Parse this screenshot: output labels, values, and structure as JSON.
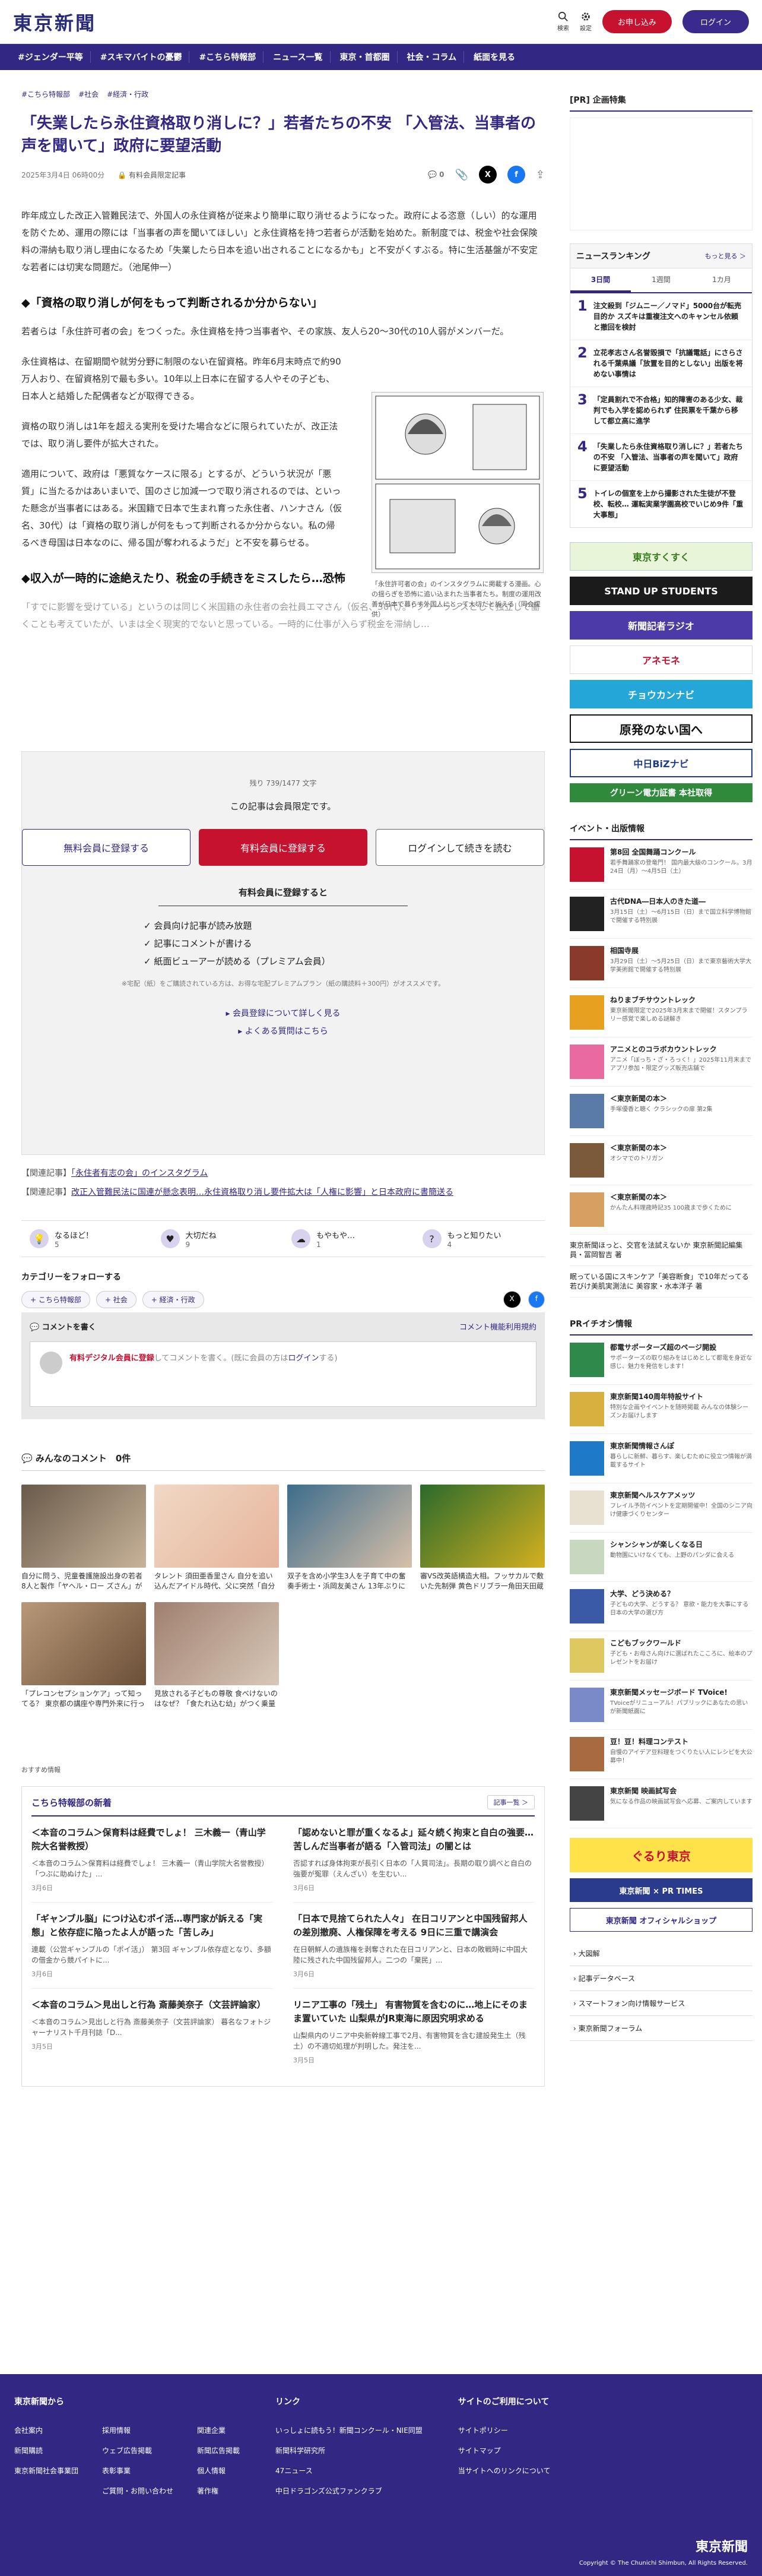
{
  "header": {
    "logo": "東京新聞",
    "search_label": "検索",
    "settings_label": "設定",
    "register": "お申し込み",
    "login": "ログイン"
  },
  "nav": [
    "#ジェンダー平等",
    "#スキマバイトの憂鬱",
    "#こちら特報部",
    "ニュース一覧",
    "東京・首都圏",
    "社会・コラム",
    "紙面を見る"
  ],
  "crumbs": [
    "#こちら特報部",
    "#社会",
    "#経済・行政"
  ],
  "article": {
    "title": "「失業したら永住資格取り消しに？」若者たちの不安 「入管法、当事者の声を聞いて」政府に要望活動",
    "date": "2025年3月4日 06時00分",
    "badge": "有料会員限定記事",
    "comment_count": "0",
    "p1": "昨年成立した改正入管難民法で、外国人の永住資格が従来より簡単に取り消せるようになった。政府による恣意（しい）的な運用を防ぐため、運用の際には「当事者の声を聞いてほしい」と永住資格を持つ若者らが活動を始めた。新制度では、税金や社会保険料の滞納も取り消し理由になるため「失業したら日本を追い出されることになるかも」と不安がくすぶる。特に生活基盤が不安定な若者には切実な問題だ。（池尾伸一）",
    "h_1": "◆「資格の取り消しが何をもって判断されるか分からない」",
    "p2": "若者らは「永住許可者の会」をつくった。永住資格を持つ当事者や、その家族、友人ら20〜30代の10人弱がメンバーだ。",
    "p3": "永住資格は、在留期間や就労分野に制限のない在留資格。昨年6月末時点で約90万人おり、在留資格別で最も多い。10年以上日本に在留する人やその子ども、日本人と結婚した配偶者などが取得できる。",
    "p4": "資格の取り消しは1年を超える実刑を受けた場合などに限られていたが、改正法では、取り消し要件が拡大された。",
    "p5": "適用について、政府は「悪質なケースに限る」とするが、どういう状況が「悪質」に当たるかはあいまいで、国のさじ加減一つで取り消されるのでは、といった懸念が当事者にはある。米国籍で日本で生まれ育った永住者、ハンナさん（仮名、30代）は「資格の取り消しが何をもって判断されるか分からない。私の帰るべき母国は日本なのに、帰る国が奪われるようだ」と不安を募らせる。",
    "h_2": "◆収入が一時的に途絶えたり、税金の手続きをミスしたら…恐怖",
    "p6": "「すでに影響を受けている」というのは同じく米国籍の永住者の会社員エマさん（仮名、30代）。「フリーランスとして独立して働くことも考えていたが、いまは全く現実的でないと思っている。一時的に仕事が入らず税金を滞納し…",
    "fig_caption": "「永住許可者の会」のインスタグラムに掲載する漫画。心の揺らぎを恐怖に追い込まれた当事者たち。制度の運用改善が日本で暮らす外国人にとって大切だと訴える（同会提供）"
  },
  "paywall": {
    "count": "残り 739/1477 文字",
    "msg": "この記事は会員限定です。",
    "free": "無料会員に登録する",
    "paid": "有料会員に登録する",
    "login": "ログインして続きを読む",
    "benefits_head": "有料会員に登録すると",
    "benefits": [
      "✓ 会員向け記事が読み放題",
      "✓ 記事にコメントが書ける",
      "✓ 紙面ビューアーが読める（プレミアム会員）"
    ],
    "note": "※宅配（紙）をご購読されている方は、お得な宅配プレミアムプラン（紙の購読料＋300円）がオススメです。",
    "link1": "会員登録について詳しく見る",
    "link2": "よくある質問はこちら"
  },
  "related": [
    {
      "label": "【関連記事】",
      "text": "「永住者有志の会」のインスタグラム"
    },
    {
      "label": "【関連記事】",
      "text": "改正入管難民法に国連が懸念表明…永住資格取り消し要件拡大は「人権に影響」と日本政府に書簡送る"
    }
  ],
  "reactions": [
    {
      "label": "なるほど！",
      "count": "5"
    },
    {
      "label": "大切だね",
      "count": "9"
    },
    {
      "label": "もやもや…",
      "count": "1"
    },
    {
      "label": "もっと知りたい",
      "count": "4"
    }
  ],
  "follow": {
    "head": "カテゴリーをフォローする",
    "chips": [
      "+ こちら特報部",
      "+ 社会",
      "+ 経済・行政"
    ]
  },
  "comments": {
    "head": "コメントを書く",
    "policy": "コメント機能利用規約",
    "ph_a": "有料デジタル会員に登録",
    "ph_b": "してコメントを書く。(既に会員の方は",
    "ph_c": "ログイン",
    "ph_d": "する)",
    "all": "みんなのコメント　0件"
  },
  "cards": [
    {
      "cap": "自分に問う、児童養護施設出身の若者8人と製作「ヤヘル・ロー ズさん」が記監督映画「花束」…"
    },
    {
      "cap": "タレント 須田亜香里さん 自分を追い込んだアイドル時代、父に突然「自分の心に貧乏ゆすり..."
    },
    {
      "cap": "双子を含め小学生3人を子育て中の奮奏手術士・浜岡友美さん 13年ぶりに「おはよう日本」..."
    },
    {
      "cap": "審VS改英語構造大相。フッサカルで敷いた先制弾 黄色ドリブラ一角田天田蔵が上位に 〜全..."
    },
    {
      "cap": "「プレコンセプションケア」って知ってる？ 東京都の講座や専門外来に行ってみた"
    },
    {
      "cap": "見放される子どもの尊敬 食べけないのはなぜ？「食たれ込む幼」がつく乗量様をよ作売..."
    }
  ],
  "rec": "おすすめ情報",
  "tokuho": {
    "head": "こちら特報部の新着",
    "more": "記事一覧 ＞",
    "items": [
      {
        "t": "＜本音のコラム＞保育料は経費でしょ！ 三木義一（青山学院大名誉教授）",
        "p": "＜本音のコラム＞保育料は経費でしょ！ 三木義一（青山学院大名誉教授） 「つぶに助ぬけた」...",
        "d": "3月6日"
      },
      {
        "t": "「認めないと罪が重くなるよ」延々続く拘束と自白の強要…苦しんだ当事者が語る「入管司法」の闇とは",
        "p": "否認すれば身体拘束が長引く日本の「人質司法」。長期の取り調べと自白の強要が冤罪（えんざい）を生むい...",
        "d": "3月6日"
      },
      {
        "t": "「ギャンブル脳」につけ込むポイ活…専門家が訴える「実態」と依存症に陥ったよ人が語った「苦しみ」",
        "p": "連載（公営ギャンブルの「ポイ活」） 第3回 ギャンブル依存症となり、多額の借金から競パイトに...",
        "d": "3月6日"
      },
      {
        "t": "「日本で見捨てられた人々」 在日コリアンと中国残留邦人の差別撤廃、人権保障を考える 9日に三重で講演会",
        "p": "在日朝鮮人の遺族権を剥奪された在日コリアンと、日本の敗戦時に中国大陸に残された中国残留邦人。二つの「棄民」...",
        "d": "3月6日"
      },
      {
        "t": "＜本音のコラム＞見出しと行為 斎藤美奈子（文芸評論家）",
        "p": "＜本音のコラム＞見出しと行為 斎藤美奈子（文芸評論家） 暮名なフォトジャーナリスト千月刊誌「D...",
        "d": "3月5日"
      },
      {
        "t": "リニア工事の「残土」 有害物質を含むのに…地上にそのまま置いていた 山梨県がJR東海に原因究明求める",
        "p": "山梨県内のリニア中央新幹線工事で2月、有害物質を含む建設発生土（残土）の不適切処理が判明した。発注を...",
        "d": "3月5日"
      }
    ]
  },
  "side": {
    "pr": "[PR] 企画特集",
    "rank_head": "ニュースランキング",
    "rank_more": "もっと見る ＞",
    "tabs": [
      "3日間",
      "1週間",
      "1カ月"
    ],
    "rank": [
      {
        "n": "1",
        "t": "注文殺到「ジムニー／ノマド」5000台が転売目的か スズキは重複注文へのキャンセル依頼と撤回を検討"
      },
      {
        "n": "2",
        "t": "立花孝志さん名誉毀損で「抗議電話」にさらされる千葉県議「放置を目的としない」出版を将めない事情は"
      },
      {
        "n": "3",
        "t": "「定員割れで不合格」知的障害のある少女、裁判でも入学を認められず 住民票を千葉から移して都立高に進学"
      },
      {
        "n": "4",
        "t": "「失業したら永住資格取り消しに？」若者たちの不安 「入管法、当事者の声を聞いて」政府に要望活動"
      },
      {
        "n": "5",
        "t": "トイレの個室を上から撮影された生徒が不登校、転校… 運転実業学園高校でいじめ9件「重大事態」"
      }
    ],
    "banners": [
      "東京すくすく",
      "STAND UP STUDENTS",
      "新聞記者ラジオ",
      "アネモネ",
      "チョウカンナビ",
      "原発のない国へ",
      "中日BiZナビ",
      "グリーン電力証書 本社取得"
    ],
    "ev_head": "イベント・出版情報",
    "events": [
      {
        "t": "第8回 全国舞踊コンクール",
        "s": "若手舞踊家の登竜門！ 国内最大級のコンクール。3月24日（月）〜4月5日（土）"
      },
      {
        "t": "古代DNA―日本人のきた道―",
        "s": "3月15日（土）〜6月15日（日）まで国立科学博物館で開催する特別展"
      },
      {
        "t": "相国寺展",
        "s": "3月29日（土）〜5月25日（日）まで東京藝術大学大学美術館で開催する特別展"
      },
      {
        "t": "ねりまブチサウントレック",
        "s": "東京新聞限定で2025年3月末まで開催！スタンプラリー感覚で楽しめる謎解き"
      },
      {
        "t": "アニメとのコラボカウントレック",
        "s": "アニメ「ぼっち・ざ・ろっく！」2025年11月末までアプリ参加・限定グッズ販売店舗で"
      },
      {
        "t": "＜東京新聞の本＞",
        "s": "手塚優香と聴く クラシックの扉 第2集"
      },
      {
        "t": "＜東京新聞の本＞",
        "s": "オシマでのトリガン"
      },
      {
        "t": "＜東京新聞の本＞",
        "s": "かんたん料理歳時記35 100歳まで歩くために"
      }
    ],
    "links": [
      "東京新聞ほっと、交官を法試えないか 東京新聞記編集員・冨岡智吉 著",
      "眠っている国にスキンケア「美容断食」で10年だってる若びけ美肌実測法に 美容家・水本洋子 著"
    ],
    "pr_head": "PRイチオシ情報",
    "prs": [
      {
        "t": "都電サポーターズ超のページ開設",
        "s": "サポーターズの取り組みをはじめとして都電を身近な感じ、魅力を発信をします！"
      },
      {
        "t": "東京新聞140周年特設サイト",
        "s": "特別な企画やイベントを随時掲載 みんなの体験シーズンお届けします"
      },
      {
        "t": "東京新聞情報さんぽ",
        "s": "暮らしに新鮮、暮らす、楽しむために役立つ情報が満載するサイト"
      },
      {
        "t": "東京新聞ヘルスケアメッツ",
        "s": "フレイル予防イベントを定期開催中！全国のシニア向け健康づくりセンター"
      },
      {
        "t": "シャンシャンが楽しくなる日",
        "s": "動物園にいけなくても、上野のパンダに会える"
      },
      {
        "t": "大学、どう決める？",
        "s": "子どもの大学、どうする？ 意欲・能力を大事にする日本の大学の選び方"
      },
      {
        "t": "こどもブックワールド",
        "s": "子ども・お母さん向けに選ばれたこころに、絵本のプレゼントをお届け"
      },
      {
        "t": "東京新聞メッセージボード TVoice!",
        "s": "TVoiceがリニューアル！パブリックにあなたの思いが新聞紙面に"
      },
      {
        "t": "豆！豆！料理コンテスト",
        "s": "自慢のアイデア豆料理をつくりたい人にレシピを大公募中！"
      },
      {
        "t": "東京新聞 映画試写会",
        "s": "気になる作品の映画試写会へ応募、ご案内しています"
      }
    ],
    "banners2": [
      "ぐるり東京",
      "東京新聞 × PR TIMES",
      "東京新聞 オフィシャルショップ"
    ],
    "sublinks": [
      "大図解",
      "記事データベース",
      "スマートフォン向け情報サービス",
      "東京新聞フォーラム"
    ]
  },
  "footer": {
    "c1": "東京新聞から",
    "c1a": [
      "会社案内",
      "新聞購読",
      "東京新聞社会事業団"
    ],
    "c1b": [
      "採用情報",
      "ウェブ広告掲載",
      "表彰事業",
      "ご質問・お問い合わせ"
    ],
    "c1c": [
      "関連企業",
      "新聞広告掲載",
      "個人情報",
      "著作権"
    ],
    "c2": "リンク",
    "c2a": [
      "いっしょに読もう！新聞コンクール・NIE同盟",
      "新聞科学研究所",
      "47ニュース",
      "中日ドラゴンズ公式ファンクラブ"
    ],
    "c3": "サイトのご利用について",
    "c3a": [
      "サイトポリシー",
      "サイトマップ",
      "当サイトへのリンクについて"
    ],
    "logo": "東京新聞",
    "copy": "Copyright © The Chunichi Shimbun, All Rights Reserved."
  }
}
